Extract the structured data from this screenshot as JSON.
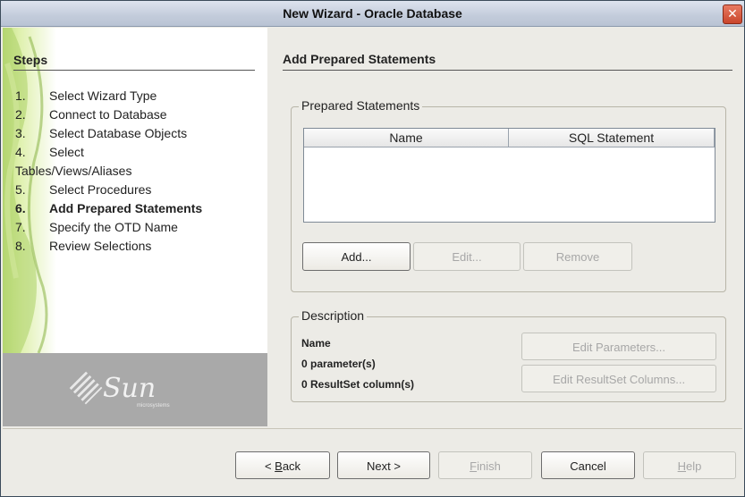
{
  "window": {
    "title": "New Wizard - Oracle Database",
    "close_label": "✕"
  },
  "steps": {
    "heading": "Steps",
    "items": [
      {
        "num": "1.",
        "label": "Select Wizard Type",
        "active": false
      },
      {
        "num": "2.",
        "label": "Connect to Database",
        "active": false
      },
      {
        "num": "3.",
        "label": "Select Database Objects",
        "active": false
      },
      {
        "num": "4.",
        "label": "Select",
        "active": false
      },
      {
        "num": "",
        "label": "Tables/Views/Aliases",
        "active": false
      },
      {
        "num": "5.",
        "label": "Select Procedures",
        "active": false
      },
      {
        "num": "6.",
        "label": "Add Prepared Statements",
        "active": true
      },
      {
        "num": "7.",
        "label": "Specify the OTD Name",
        "active": false
      },
      {
        "num": "8.",
        "label": "Review Selections",
        "active": false
      }
    ],
    "logo_text": "Sun",
    "logo_subtext": "microsystems"
  },
  "main": {
    "title": "Add Prepared Statements",
    "prepared_group": {
      "legend": "Prepared Statements",
      "columns": [
        "Name",
        "SQL Statement"
      ],
      "rows": [],
      "buttons": {
        "add": "Add...",
        "edit": "Edit...",
        "remove": "Remove"
      }
    },
    "description_group": {
      "legend": "Description",
      "name_label": "Name",
      "parameters_text": "0 parameter(s)",
      "resultset_text": "0 ResultSet column(s)",
      "edit_parameters": "Edit Parameters...",
      "edit_resultset": "Edit ResultSet Columns..."
    }
  },
  "footer": {
    "back_prefix": "< ",
    "back_mnemonic": "B",
    "back_rest": "ack",
    "next": "Next >",
    "finish_mnemonic": "F",
    "finish_rest": "inish",
    "cancel": "Cancel",
    "help_mnemonic": "H",
    "help_rest": "elp"
  }
}
